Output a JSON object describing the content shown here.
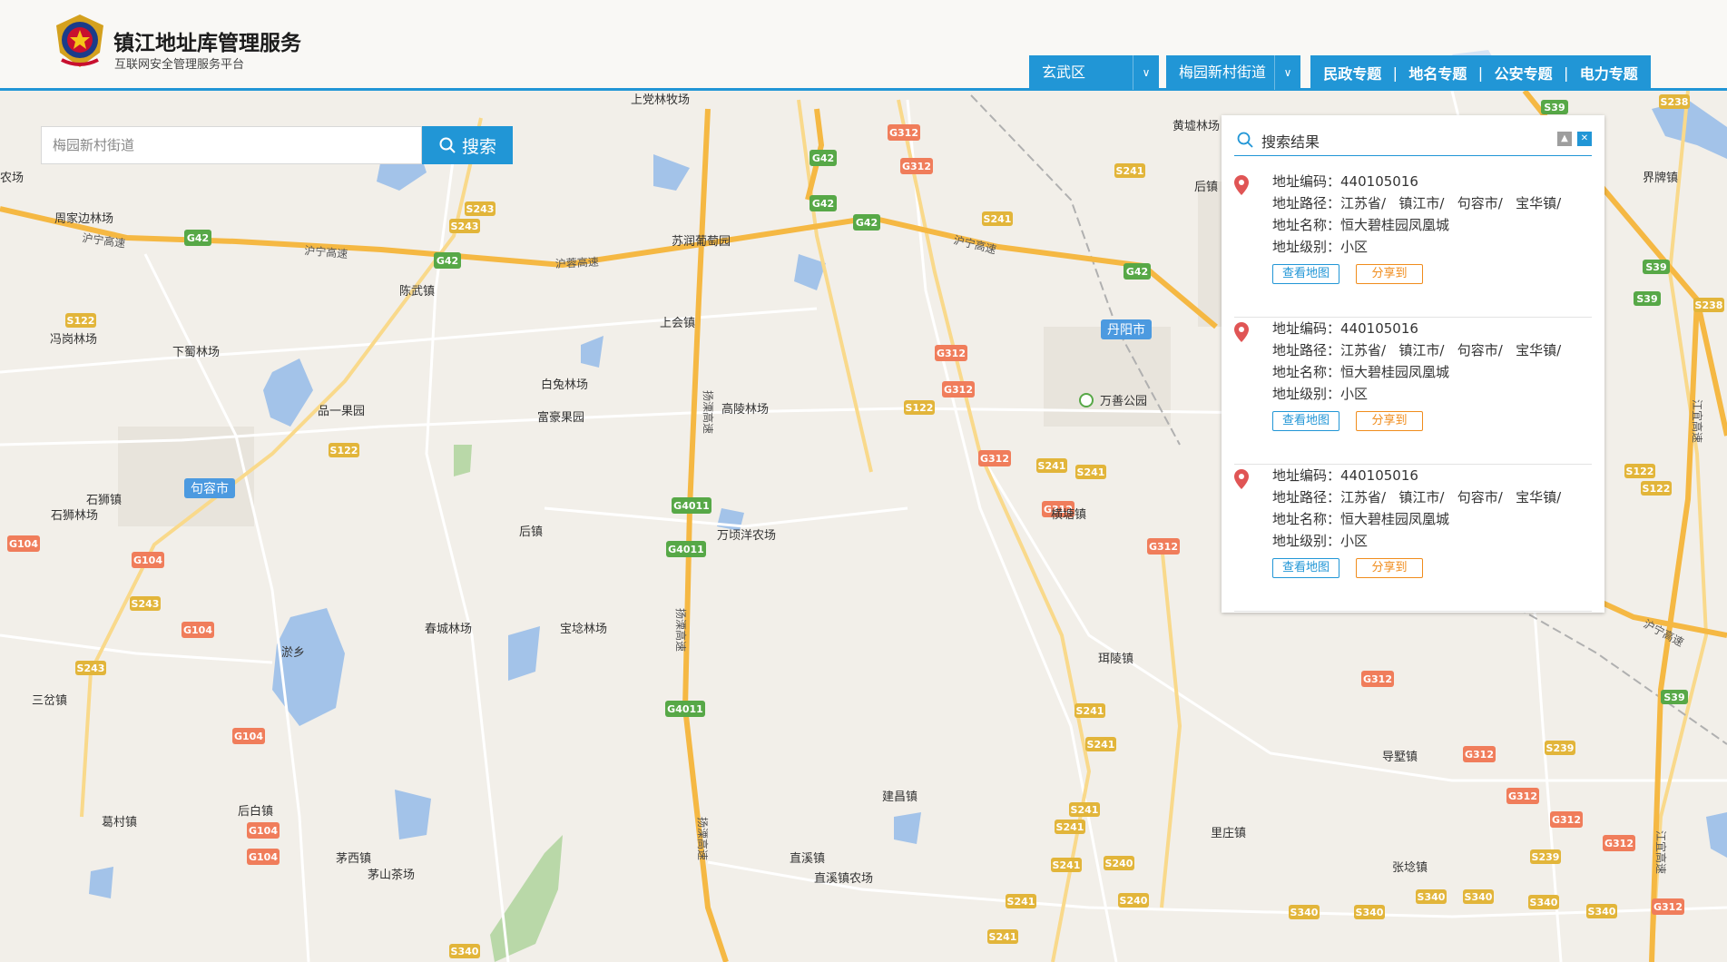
{
  "header": {
    "title": "镇江地址库管理服务",
    "subtitle": "互联网安全管理服务平台"
  },
  "filters": {
    "district": "玄武区",
    "street": "梅园新村街道"
  },
  "topics": [
    "民政专题",
    "地名专题",
    "公安专题",
    "电力专题"
  ],
  "search": {
    "placeholder": "梅园新村街道",
    "button_label": "搜索"
  },
  "results_panel": {
    "title": "搜索结果",
    "items": [
      {
        "code_label": "地址编码：",
        "code": "440105016",
        "path_label": "地址路径：",
        "path": "江苏省/   镇江市/   句容市/   宝华镇/",
        "name_label": "地址名称：",
        "name": "恒大碧桂园凤凰城",
        "level_label": "地址级别：",
        "level": "小区",
        "view_label": "查看地图",
        "share_label": "分享到"
      },
      {
        "code_label": "地址编码：",
        "code": "440105016",
        "path_label": "地址路径：",
        "path": "江苏省/   镇江市/   句容市/   宝华镇/",
        "name_label": "地址名称：",
        "name": "恒大碧桂园凤凰城",
        "level_label": "地址级别：",
        "level": "小区",
        "view_label": "查看地图",
        "share_label": "分享到"
      },
      {
        "code_label": "地址编码：",
        "code": "440105016",
        "path_label": "地址路径：",
        "path": "江苏省/   镇江市/   句容市/   宝华镇/",
        "name_label": "地址名称：",
        "name": "恒大碧桂园凤凰城",
        "level_label": "地址级别：",
        "level": "小区",
        "view_label": "查看地图",
        "share_label": "分享到"
      }
    ]
  },
  "map": {
    "cities": [
      "句容市",
      "丹阳市"
    ],
    "places": [
      "农场",
      "周家边林场",
      "陈武镇",
      "冯岗林场",
      "下蜀林场",
      "品一果园",
      "石狮镇",
      "石狮林场",
      "上会镇",
      "白兔林场",
      "富豪果园",
      "高陵林场",
      "苏润葡萄园",
      "万善公园",
      "横塘镇",
      "后镇",
      "万顷洋农场",
      "春城林场",
      "宝埝林场",
      "淤乡",
      "三岔镇",
      "珥陵镇",
      "导墅镇",
      "建昌镇",
      "里庄镇",
      "张埝镇",
      "后白镇",
      "葛村镇",
      "茅西镇",
      "茅山茶场",
      "直溪镇",
      "直溪镇农场",
      "黄墟林场",
      "界牌镇",
      "上党林牧场",
      "后镇"
    ],
    "road_names": [
      "沪宁高速",
      "沪蓉高速",
      "扬溧高速",
      "江宜高速"
    ],
    "shields": {
      "G42": "G42",
      "G4011": "G4011",
      "G312": "G312",
      "G104": "G104",
      "S122": "S122",
      "S243": "S243",
      "S241": "S241",
      "S39": "S39",
      "S238": "S238",
      "S239": "S239",
      "S240": "S240",
      "S340": "S340"
    },
    "colors": {
      "land": "#f2efe9",
      "water": "#a3c3e9",
      "expressway": "#f5b843",
      "road": "#ffffff",
      "national_shield": "#f07d5b",
      "provincial_shield": "#e2b53a",
      "expressway_shield": "#57a847",
      "accent": "#2196d6"
    }
  }
}
